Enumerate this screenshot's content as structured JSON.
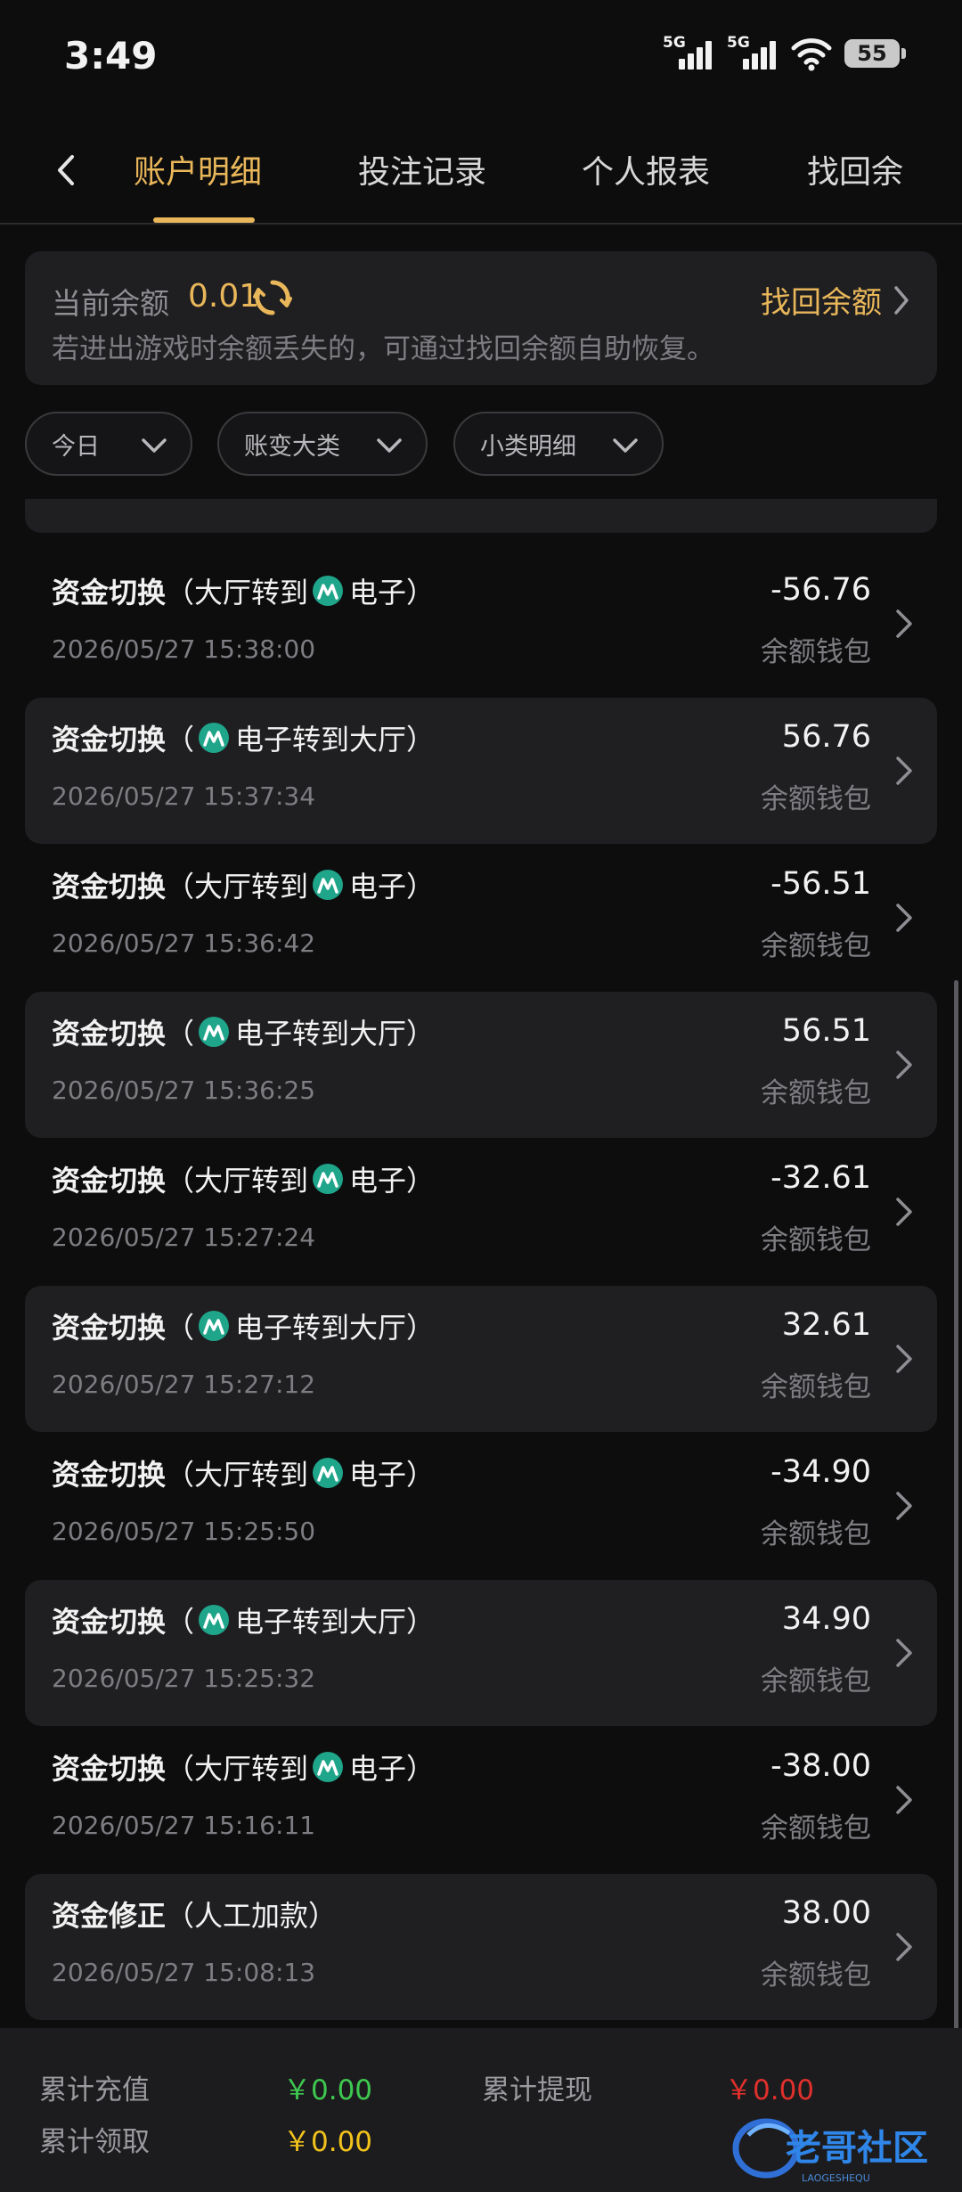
{
  "status_bar": {
    "time": "3:49",
    "net1": "5G",
    "net2": "5G",
    "battery": "55"
  },
  "tabs": [
    {
      "label": "账户明细",
      "active": true
    },
    {
      "label": "投注记录",
      "active": false
    },
    {
      "label": "个人报表",
      "active": false
    },
    {
      "label": "找回余",
      "active": false
    }
  ],
  "balance": {
    "label": "当前余额",
    "value": "0.01",
    "recover_label": "找回余额",
    "hint": "若进出游戏时余额丢失的，可通过找回余额自助恢复。"
  },
  "filters": [
    {
      "label": "今日"
    },
    {
      "label": "账变大类"
    },
    {
      "label": "小类明细"
    }
  ],
  "transactions": [
    {
      "prefix": "资金切换",
      "open": "（",
      "before": "大厅转到",
      "icon": true,
      "after": "电子）",
      "icon_first": false,
      "date": "2026/05/27 15:38:00",
      "amount": "-56.76",
      "wallet": "余额钱包"
    },
    {
      "prefix": "资金切换",
      "open": "（",
      "before": "",
      "icon": true,
      "after": "电子转到大厅）",
      "icon_first": true,
      "date": "2026/05/27 15:37:34",
      "amount": "56.76",
      "wallet": "余额钱包"
    },
    {
      "prefix": "资金切换",
      "open": "（",
      "before": "大厅转到",
      "icon": true,
      "after": "电子）",
      "icon_first": false,
      "date": "2026/05/27 15:36:42",
      "amount": "-56.51",
      "wallet": "余额钱包"
    },
    {
      "prefix": "资金切换",
      "open": "（",
      "before": "",
      "icon": true,
      "after": "电子转到大厅）",
      "icon_first": true,
      "date": "2026/05/27 15:36:25",
      "amount": "56.51",
      "wallet": "余额钱包"
    },
    {
      "prefix": "资金切换",
      "open": "（",
      "before": "大厅转到",
      "icon": true,
      "after": "电子）",
      "icon_first": false,
      "date": "2026/05/27 15:27:24",
      "amount": "-32.61",
      "wallet": "余额钱包"
    },
    {
      "prefix": "资金切换",
      "open": "（",
      "before": "",
      "icon": true,
      "after": "电子转到大厅）",
      "icon_first": true,
      "date": "2026/05/27 15:27:12",
      "amount": "32.61",
      "wallet": "余额钱包"
    },
    {
      "prefix": "资金切换",
      "open": "（",
      "before": "大厅转到",
      "icon": true,
      "after": "电子）",
      "icon_first": false,
      "date": "2026/05/27 15:25:50",
      "amount": "-34.90",
      "wallet": "余额钱包"
    },
    {
      "prefix": "资金切换",
      "open": "（",
      "before": "",
      "icon": true,
      "after": "电子转到大厅）",
      "icon_first": true,
      "date": "2026/05/27 15:25:32",
      "amount": "34.90",
      "wallet": "余额钱包"
    },
    {
      "prefix": "资金切换",
      "open": "（",
      "before": "大厅转到",
      "icon": true,
      "after": "电子）",
      "icon_first": false,
      "date": "2026/05/27 15:16:11",
      "amount": "-38.00",
      "wallet": "余额钱包"
    },
    {
      "prefix": "资金修正",
      "open": "（",
      "before": "人工加款）",
      "icon": false,
      "after": "",
      "icon_first": false,
      "date": "2026/05/27 15:08:13",
      "amount": "38.00",
      "wallet": "余额钱包"
    }
  ],
  "footer": {
    "recharge_label": "累计充值",
    "recharge_value": "￥0.00",
    "withdraw_label": "累计提现",
    "withdraw_value": "￥0.00",
    "claim_label": "累计领取",
    "claim_value": "￥0.00"
  },
  "colors": {
    "accent": "#e9b75a",
    "green": "#3ec84f",
    "red": "#e0302c",
    "yellow": "#f2c21c"
  },
  "icons": {
    "game_icon": "teal-game-logo-icon"
  }
}
